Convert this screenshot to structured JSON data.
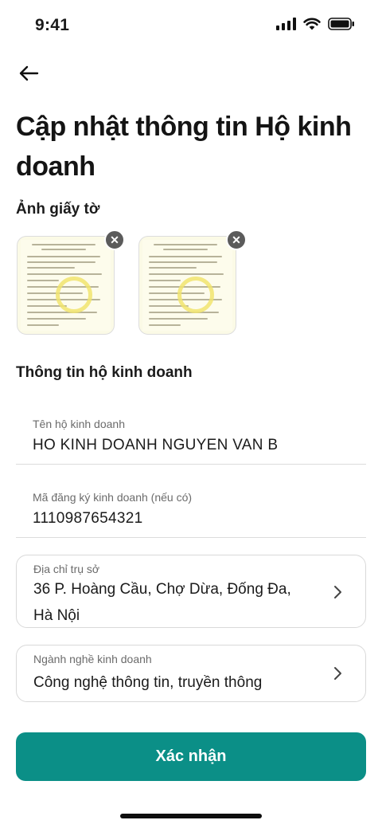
{
  "status_bar": {
    "time": "9:41"
  },
  "header": {
    "title": "Cập nhật thông tin Hộ kinh doanh"
  },
  "documents": {
    "section_label": "Ảnh giấy tờ",
    "items": [
      {
        "remove_icon": "close-icon"
      },
      {
        "remove_icon": "close-icon"
      }
    ]
  },
  "business_info": {
    "section_label": "Thông tin hộ kinh doanh",
    "name": {
      "label": "Tên hộ kinh doanh",
      "value": "HO KINH DOANH NGUYEN VAN B"
    },
    "registration": {
      "label": "Mã đăng ký kinh doanh (nếu có)",
      "value": "1110987654321"
    },
    "address": {
      "label": "Địa chỉ trụ sở",
      "value": "36 P. Hoàng Cầu, Chợ Dừa, Đống Đa, Hà Nội"
    },
    "industry": {
      "label": "Ngành nghề kinh doanh",
      "value": "Công nghệ thông tin, truyền thông"
    }
  },
  "actions": {
    "confirm_label": "Xác nhận"
  },
  "colors": {
    "primary": "#0b8f87",
    "text": "#1b1b1b",
    "muted": "#6b6b6b",
    "border": "#d9d9d9"
  }
}
